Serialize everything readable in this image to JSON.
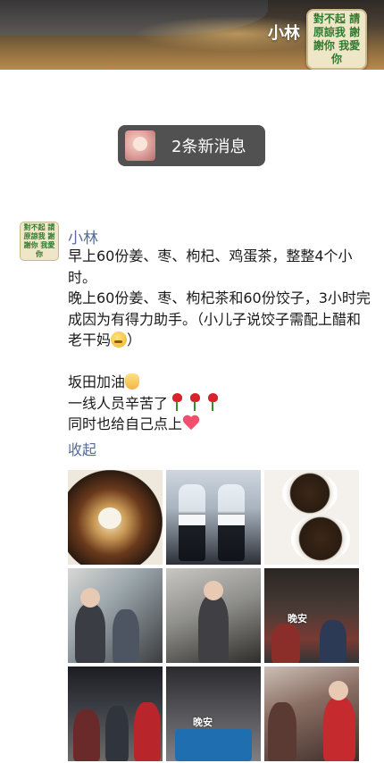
{
  "header": {
    "contact_name": "小林",
    "avatar_text": "對不起 請原諒我 謝謝你 我愛你"
  },
  "toast": {
    "label": "2条新消息"
  },
  "post": {
    "author": "小林",
    "avatar_text": "對不起 請原諒我 謝謝你 我愛你",
    "lines": {
      "l1": "早上60份姜、枣、枸杞、鸡蛋茶，整整4个小时。",
      "l2": "晚上60份姜、枣、枸杞茶和60份饺子，3小时完成因为有得力助手。（小儿子说饺子需配上醋和老干妈",
      "l2_end": "）",
      "l3": "坂田加油",
      "l4": "一线人员辛苦了",
      "l5": "同时也给自己点上"
    },
    "collapse_label": "收起"
  },
  "photos": {
    "watermark_6": "晚安",
    "watermark_8": "晚安"
  }
}
